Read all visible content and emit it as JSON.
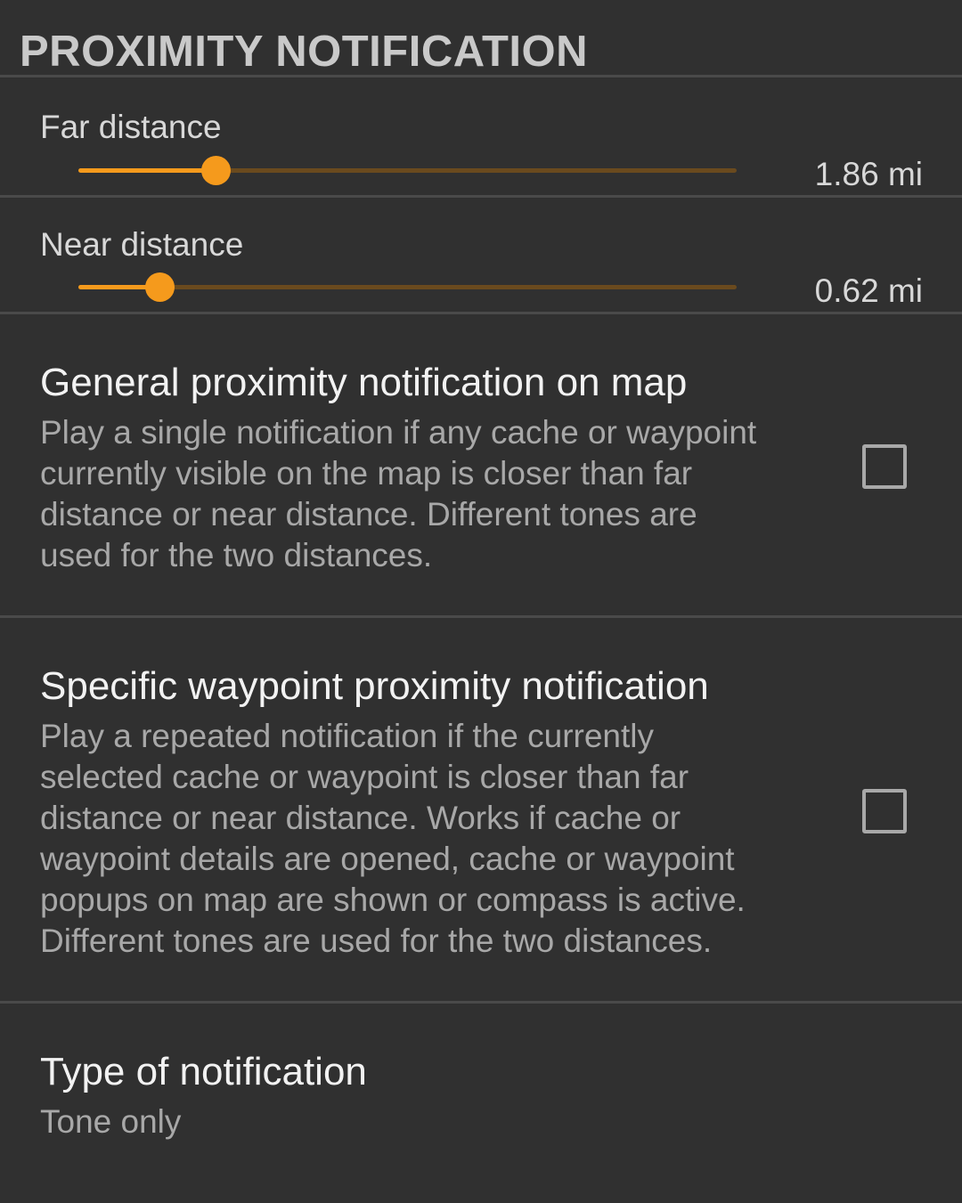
{
  "section": {
    "title": "PROXIMITY NOTIFICATION"
  },
  "far_distance": {
    "title": "Far distance",
    "value_text": "1.86 mi",
    "slider_fraction": 0.208
  },
  "near_distance": {
    "title": "Near distance",
    "value_text": "0.62 mi",
    "slider_fraction": 0.123
  },
  "general_notification": {
    "title": "General proximity notification on map",
    "summary_lines": [
      "Play a single notification if any cache or waypoint",
      "currently visible on the map is closer than far",
      "distance or near distance. Different tones are",
      "used for the two distances."
    ],
    "checked": false
  },
  "specific_notification": {
    "title": "Specific waypoint proximity notification",
    "summary_lines": [
      "Play a repeated notification if the currently",
      "selected cache or waypoint is closer than far",
      "distance or near distance. Works if cache or",
      "waypoint details are opened, cache or waypoint",
      "popups on map are shown or compass is active.",
      "Different tones are used for the two distances."
    ],
    "checked": false
  },
  "notification_type": {
    "title": "Type of notification",
    "value": "Tone only"
  },
  "colors": {
    "accent": "#f59a1c",
    "track_inactive": "#6a4a1e",
    "background": "#303030",
    "divider": "#4a4a4a"
  }
}
